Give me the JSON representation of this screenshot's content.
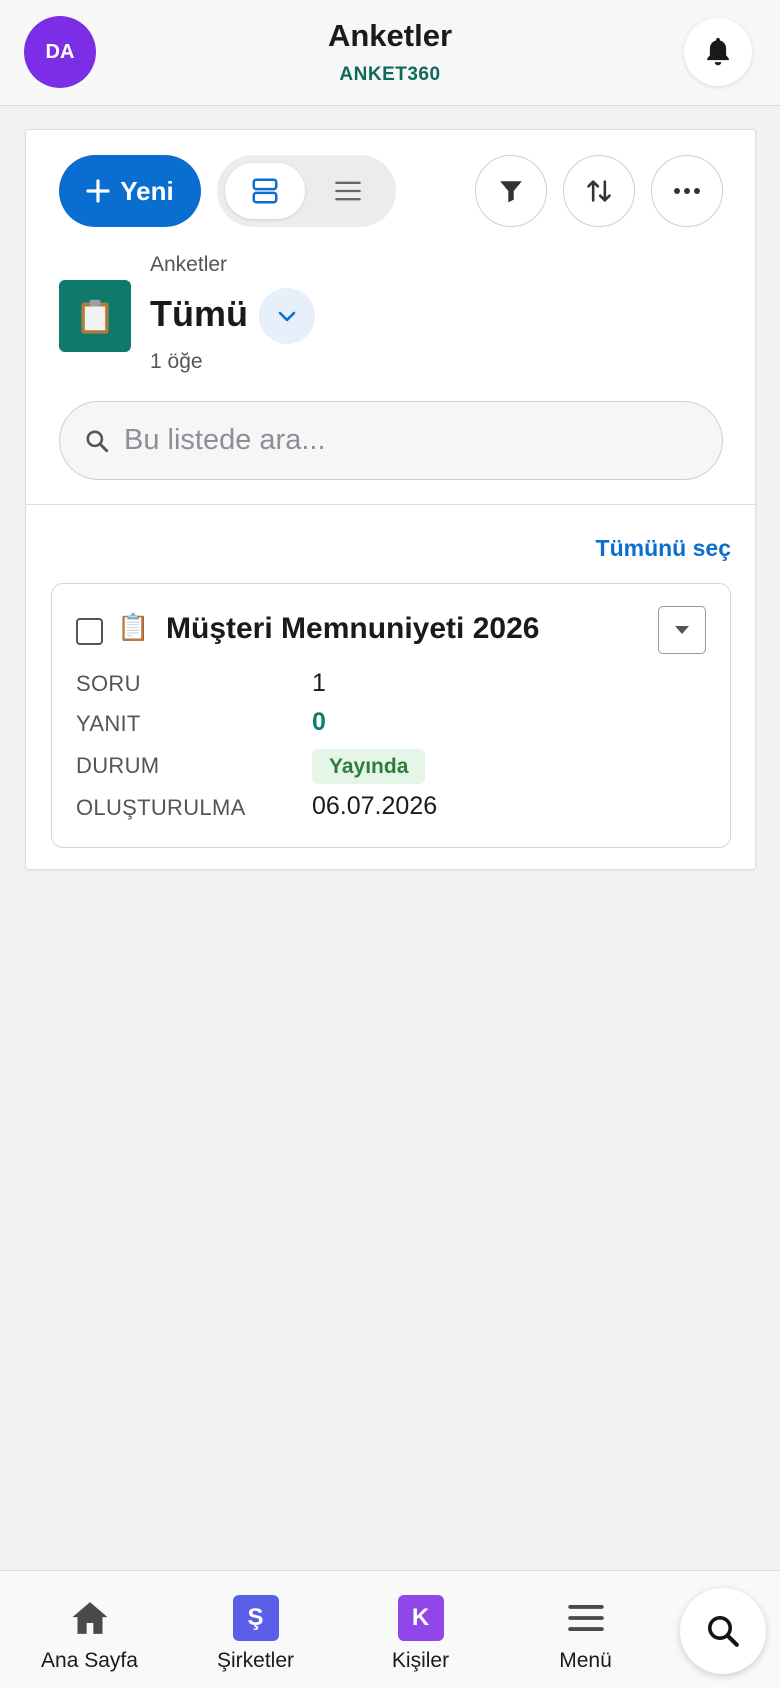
{
  "header": {
    "avatar_initials": "DA",
    "title": "Anketler",
    "subtitle": "ANKET360"
  },
  "toolbar": {
    "new_label": "Yeni",
    "view_modes": [
      "card",
      "list"
    ],
    "active_view": "card"
  },
  "list_view": {
    "module_label": "Anketler",
    "view_name": "Tümü",
    "item_count": "1 öğe",
    "search_placeholder": "Bu listede ara...",
    "select_all_label": "Tümünü seç"
  },
  "records": [
    {
      "icon": "📋",
      "title": "Müşteri Memnuniyeti 2026",
      "fields": [
        {
          "label": "SORU",
          "value": "1"
        },
        {
          "label": "YANIT",
          "value": "0"
        },
        {
          "label": "DURUM",
          "value": "Yayında"
        },
        {
          "label": "OLUŞTURULMA",
          "value": "06.07.2026"
        }
      ]
    }
  ],
  "bottom_nav": {
    "items": [
      {
        "label": "Ana Sayfa",
        "icon": "home-icon"
      },
      {
        "label": "Şirketler",
        "icon": "Ş"
      },
      {
        "label": "Kişiler",
        "icon": "K"
      },
      {
        "label": "Menü",
        "icon": "menu-icon"
      }
    ]
  },
  "colors": {
    "primary": "#0a6ed1",
    "avatar": "#7c2ee6",
    "brand_green": "#0e6b5b",
    "module_tile": "#0f7a6c",
    "companies_tile": "#5b5fe8",
    "contacts_tile": "#9046e8",
    "status_bg": "#e5f5e8",
    "status_text": "#2f7d3a"
  }
}
